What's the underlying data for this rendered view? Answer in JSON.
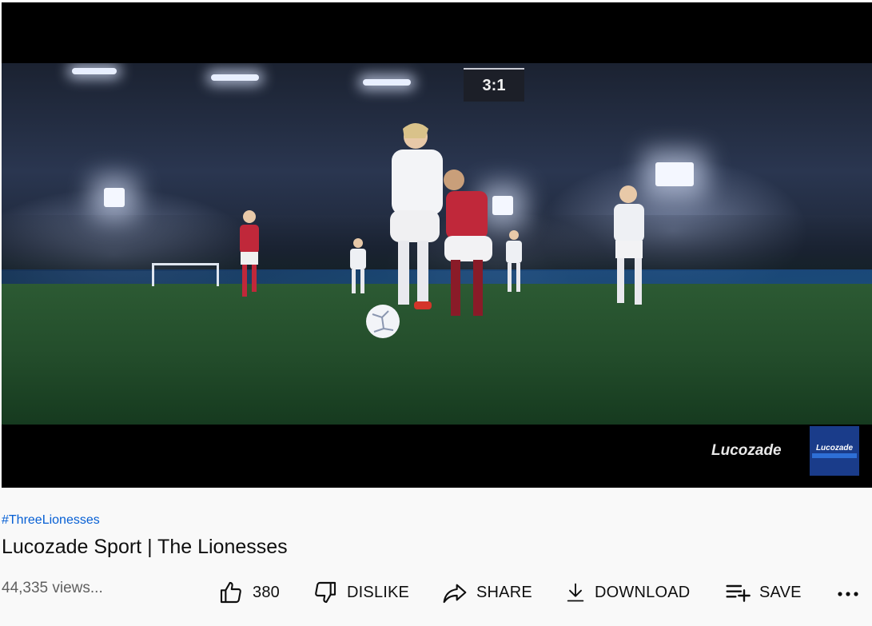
{
  "video": {
    "scoreboard_text": "3:1",
    "logo_text": "Lucozade",
    "logo_box_text": "Lucozade"
  },
  "info": {
    "hashtag": "#ThreeLionesses",
    "title": "Lucozade Sport | The Lionesses",
    "views": "44,335 views..."
  },
  "actions": {
    "like_count": "380",
    "dislike_label": "DISLIKE",
    "share_label": "SHARE",
    "download_label": "DOWNLOAD",
    "save_label": "SAVE"
  },
  "icons": {
    "like": "thumbs-up-icon",
    "dislike": "thumbs-down-icon",
    "share": "share-arrow-icon",
    "download": "download-icon",
    "save": "playlist-add-icon",
    "more": "more-horizontal-icon"
  },
  "colors": {
    "hashtag": "#065fd4",
    "background": "#f9f9f9",
    "views_text": "#606060"
  }
}
